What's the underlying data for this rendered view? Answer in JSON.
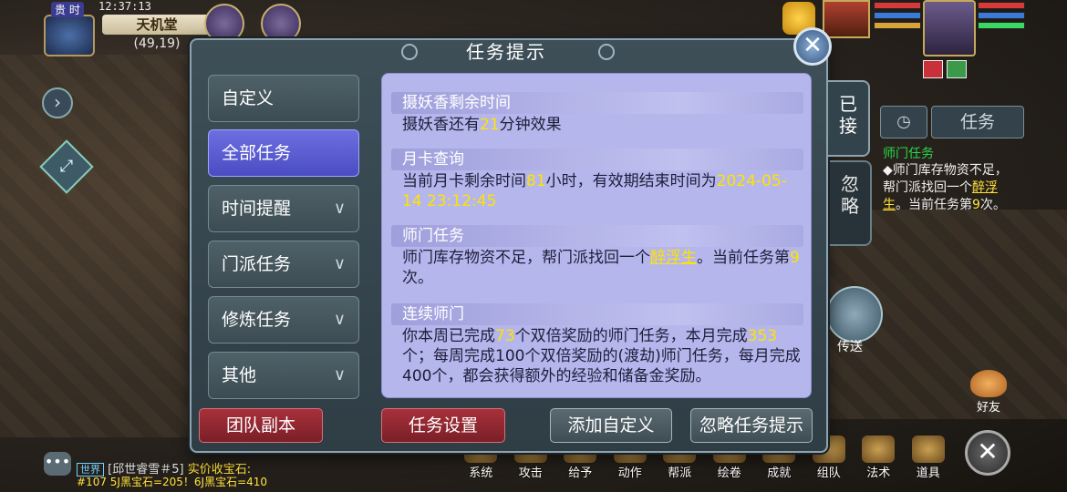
{
  "hud": {
    "vip": "贵 时",
    "clock": "12:37:13",
    "map_name": "天机堂",
    "coords": "(49,19)"
  },
  "dialog": {
    "title": "任务提示",
    "close_icon": "close-icon",
    "categories": [
      {
        "label": "自定义",
        "active": false,
        "expandable": false
      },
      {
        "label": "全部任务",
        "active": true,
        "expandable": false
      },
      {
        "label": "时间提醒",
        "active": false,
        "expandable": true
      },
      {
        "label": "门派任务",
        "active": false,
        "expandable": true
      },
      {
        "label": "修炼任务",
        "active": false,
        "expandable": true
      },
      {
        "label": "其他",
        "active": false,
        "expandable": true
      }
    ],
    "sections": [
      {
        "head": "摄妖香剩余时间",
        "body_parts": [
          "摄妖香还有",
          "21",
          "分钟效果"
        ]
      },
      {
        "head": "月卡查询",
        "body_parts": [
          "当前月卡剩余时间",
          "81",
          "小时，有效期结束时间为",
          "2024-05-14 23:12:45"
        ]
      },
      {
        "head": "师门任务",
        "body_parts": [
          "师门库存物资不足，帮门派找回一个",
          "醉浮生",
          "。当前任务第",
          "9",
          "次。"
        ]
      },
      {
        "head": "连续师门",
        "body_parts": [
          "你本周已完成",
          "73",
          "个双倍奖励的师门任务，本月完成",
          "353",
          "个；每周完成100个双倍奖励的(渡劫)师门任务，每月完成400个，都会获得额外的经验和储备金奖励。"
        ]
      }
    ],
    "buttons": {
      "team_dungeon": "团队副本",
      "task_settings": "任务设置",
      "add_custom": "添加自定义",
      "ignore_tips": "忽略任务提示"
    },
    "side_tabs": {
      "accepted": "已接",
      "ignored": "忽略"
    }
  },
  "tracker": {
    "tab_task": "任务",
    "title": "师门任务",
    "body_parts": [
      "◆师门库存物资不足，帮门派找回一个",
      "醉浮生",
      "。当前任务第",
      "9",
      "次。"
    ]
  },
  "right": {
    "teleport": "传送",
    "friends": "好友"
  },
  "bottom_menu": [
    "系统",
    "攻击",
    "给予",
    "动作",
    "帮派",
    "绘卷",
    "成就",
    "组队",
    "法术",
    "道具"
  ],
  "chat": {
    "channel": "世界",
    "name": "[邱世睿雪＃5]",
    "msg": "实价收宝石:",
    "line2": "#107 5J黑宝石=205！6J黑宝石=410"
  },
  "colors": {
    "accent_active": "#5b5ed6",
    "red_button": "#8f2631",
    "highlight_yellow": "#ffe300",
    "content_bg": "#b5b6ec",
    "tracker_green": "#29d84a"
  }
}
